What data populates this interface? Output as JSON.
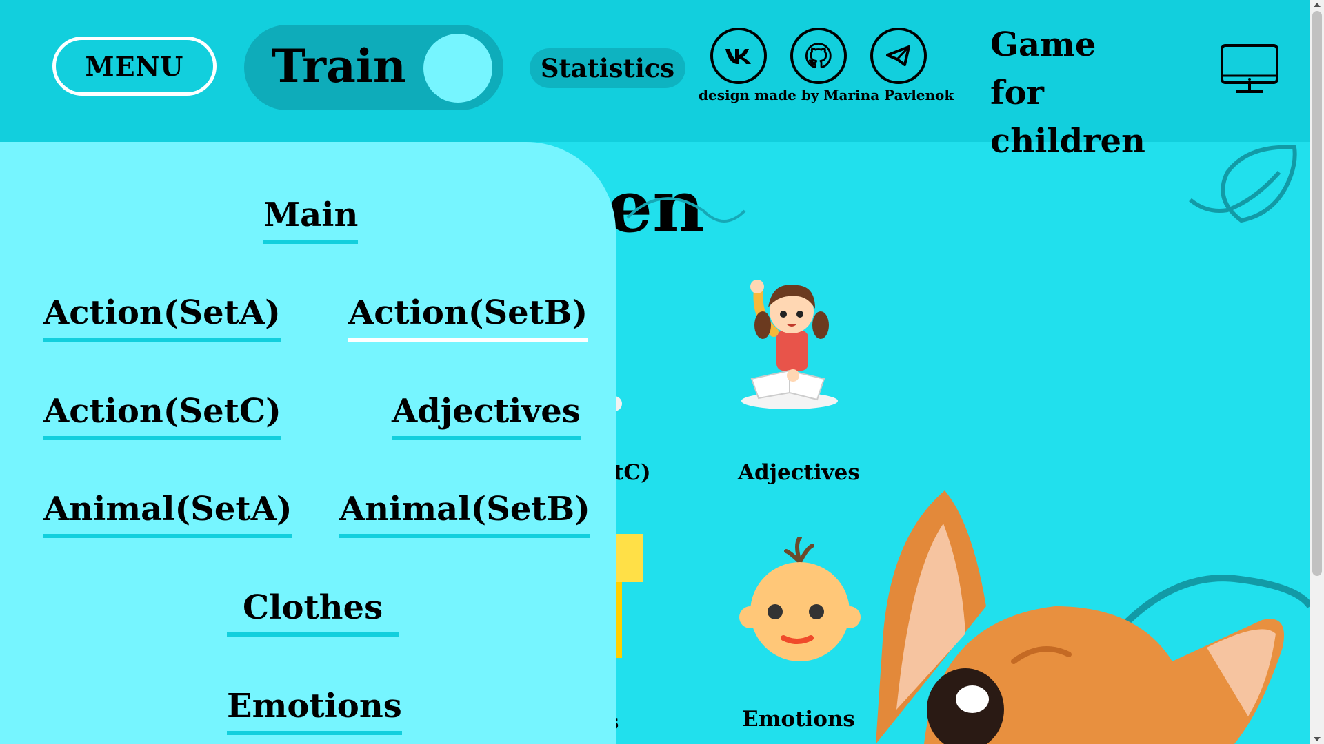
{
  "header": {
    "menu_label": "MENU",
    "mode_label": "Train",
    "statistics_label": "Statistics",
    "credit": "design made by Marina Pavlenok",
    "title_line1": "Game for",
    "title_line2": "children",
    "social_icons": [
      "vk-icon",
      "github-icon",
      "telegram-icon"
    ],
    "view_icon": "monitor-icon"
  },
  "main": {
    "heading_partial": "en",
    "categories": [
      {
        "label_partial": "tC)",
        "icon": "cat-partial-icon"
      },
      {
        "label": "Adjectives",
        "icon": "girl-reading-icon"
      },
      {
        "label_partial": "s",
        "icon": "yellow-partial-icon"
      },
      {
        "label": "Emotions",
        "icon": "baby-face-icon"
      }
    ]
  },
  "side_menu": {
    "items": [
      {
        "label": "Main",
        "active": false
      },
      {
        "label": "Action(SetA)",
        "active": false
      },
      {
        "label": "Action(SetB)",
        "active": true
      },
      {
        "label": "Action(SetC)",
        "active": false
      },
      {
        "label": "Adjectives",
        "active": false
      },
      {
        "label": "Animal(SetA)",
        "active": false
      },
      {
        "label": "Animal(SetB)",
        "active": false
      },
      {
        "label": "Clothes",
        "active": false
      },
      {
        "label": "Emotions",
        "active": false
      }
    ]
  },
  "colors": {
    "header_bg": "#12cfdd",
    "page_bg": "#21e0ed",
    "menu_bg": "#76f5ff",
    "toggle_bg": "#0eacba",
    "underline": "#12cfdd",
    "active_underline": "#ffffff"
  }
}
